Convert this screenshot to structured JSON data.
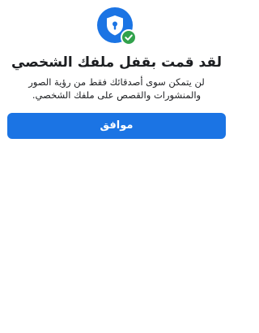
{
  "colors": {
    "accent": "#1b74e4",
    "success": "#31a24c"
  },
  "icons": {
    "main": "profile-lock-icon",
    "badge": "checkmark-icon"
  },
  "dialog": {
    "title": "لقد قمت بقفل ملفك الشخصي",
    "description_line1": "لن يتمكن سوى أصدقائك فقط من رؤية الصور",
    "description_line2": "والمنشورات والقصص على ملفك الشخصي.",
    "ok_label": "موافق"
  }
}
